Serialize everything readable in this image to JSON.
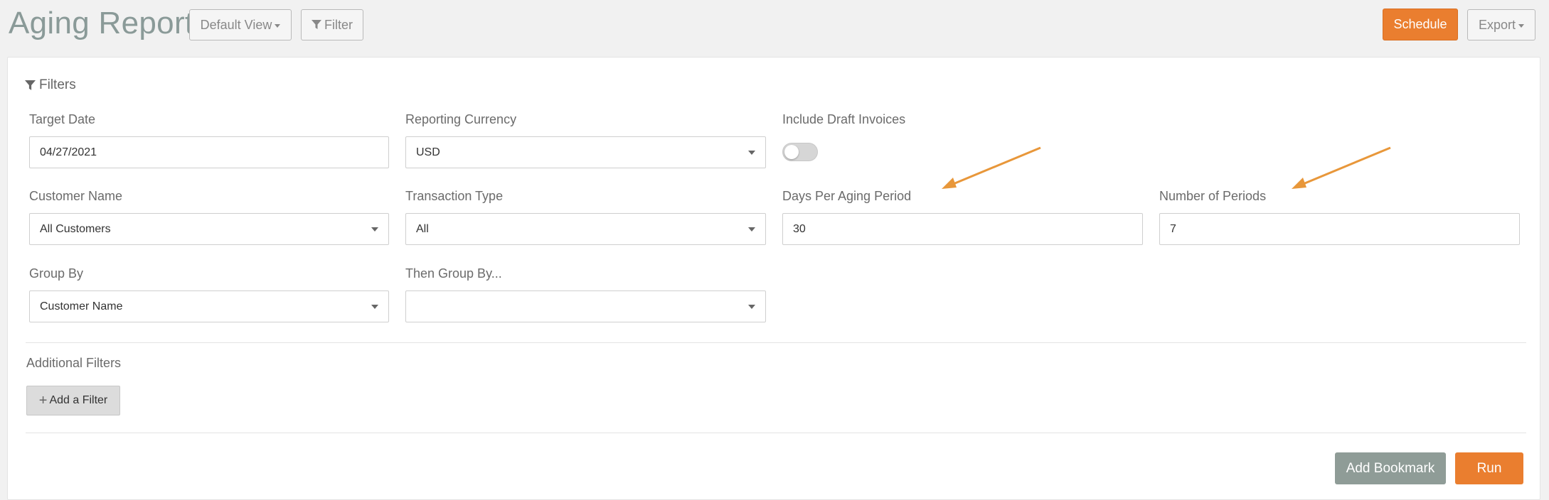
{
  "header": {
    "title": "Aging Report",
    "default_view_label": "Default View",
    "filter_label": "Filter",
    "schedule_label": "Schedule",
    "export_label": "Export"
  },
  "filters": {
    "heading": "Filters",
    "target_date": {
      "label": "Target Date",
      "value": "04/27/2021"
    },
    "reporting_currency": {
      "label": "Reporting Currency",
      "value": "USD"
    },
    "include_draft": {
      "label": "Include Draft Invoices",
      "checked": false
    },
    "customer_name": {
      "label": "Customer Name",
      "value": "All Customers"
    },
    "transaction_type": {
      "label": "Transaction Type",
      "value": "All"
    },
    "days_per_period": {
      "label": "Days Per Aging Period",
      "value": "30"
    },
    "number_of_periods": {
      "label": "Number of Periods",
      "value": "7"
    },
    "group_by": {
      "label": "Group By",
      "value": "Customer Name"
    },
    "then_group_by": {
      "label": "Then Group By...",
      "value": ""
    }
  },
  "additional_filters": {
    "heading": "Additional Filters",
    "add_label": "Add a Filter"
  },
  "actions": {
    "bookmark_label": "Add Bookmark",
    "run_label": "Run"
  },
  "colors": {
    "accent": "#ea7e2f",
    "secondary": "#8f9c97",
    "annotation_arrow": "#e8973a"
  }
}
